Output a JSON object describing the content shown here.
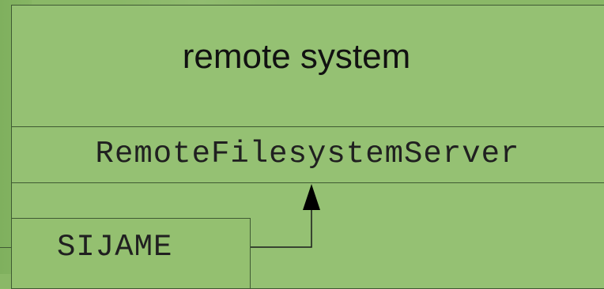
{
  "diagram": {
    "component_title": "remote system",
    "class_name": "RemoteFilesystemServer",
    "client_label": "SIJAME"
  },
  "colors": {
    "background": "#8ab867",
    "box_fill": "#95c173",
    "border": "#3f5a33",
    "text": "#111111"
  }
}
